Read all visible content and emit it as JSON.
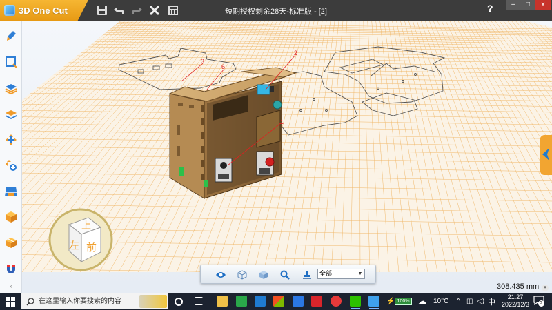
{
  "app": {
    "name": "3D One Cut",
    "document_title": "短期授权剩余28天-标准版 - [2]",
    "help_label": "?",
    "window_controls": {
      "minimize": "–",
      "maximize": "□",
      "close": "x"
    }
  },
  "toolbar": {
    "icons": [
      "save-icon",
      "undo-icon",
      "redo-icon",
      "delete-icon",
      "calculator-icon"
    ]
  },
  "left_tools": [
    "pen-brush-icon",
    "sketch-icon",
    "layers-icon",
    "stack-icon",
    "move-icon",
    "transform-add-icon",
    "layout-icon",
    "cube-icon",
    "box-icon",
    "magnet-icon"
  ],
  "viewcube": {
    "top": "上",
    "left": "左",
    "front": "前"
  },
  "annotations": [
    "3",
    "6",
    "2",
    "1"
  ],
  "bottom_toolbar": {
    "icons": [
      "eye-icon",
      "cube-outline-icon",
      "cube-shaded-icon",
      "zoom-icon",
      "stamp-icon"
    ],
    "filter_value": "全部"
  },
  "status": {
    "scale_value": "308.435 mm"
  },
  "taskbar": {
    "search_placeholder": "在这里输入你要搜索的内容",
    "battery": "100%",
    "weather": "10°C",
    "ime": "中",
    "time": "21:27",
    "date": "2022/12/3",
    "notifications": "2"
  },
  "colors": {
    "accent": "#f2a531",
    "wood": "#b08a55",
    "wood_dark": "#7b5c33",
    "grid_line": "#f0b86a",
    "titlebar": "#3c3c3c",
    "annotation": "#e02020"
  }
}
